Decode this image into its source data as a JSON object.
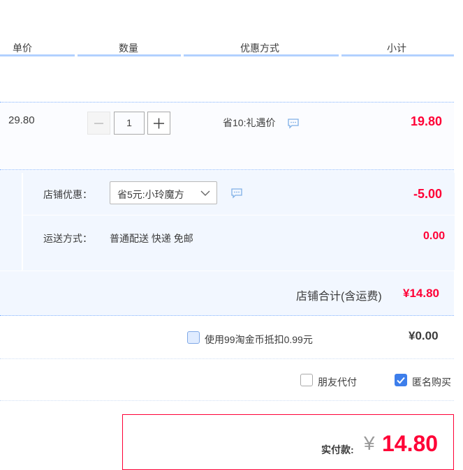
{
  "header": {
    "col_price": "单价",
    "col_qty": "数量",
    "col_discount": "优惠方式",
    "col_subtotal": "小计"
  },
  "item": {
    "unit_price": "29.80",
    "quantity": "1",
    "discount_text": "省10:礼遇价",
    "subtotal": "19.80"
  },
  "shop": {
    "discount_label": "店铺优惠：",
    "discount_selected": "省5元:小玲魔方",
    "discount_amount": "-5.00",
    "shipping_label": "运送方式：",
    "shipping_value": "普通配送 快递 免邮",
    "shipping_cost": "0.00",
    "total_label": "店铺合计(含运费)",
    "total_value": "¥14.80"
  },
  "coins": {
    "label": "使用99淘金币抵扣0.99元",
    "value": "¥0.00"
  },
  "options": {
    "friend_pay": "朋友代付",
    "anonymous": "匿名购买"
  },
  "payment": {
    "label": "实付款:",
    "currency": "¥",
    "amount": "14.80"
  },
  "colors": {
    "accent_red": "#ff0036",
    "accent_blue": "#3d7eeb"
  }
}
